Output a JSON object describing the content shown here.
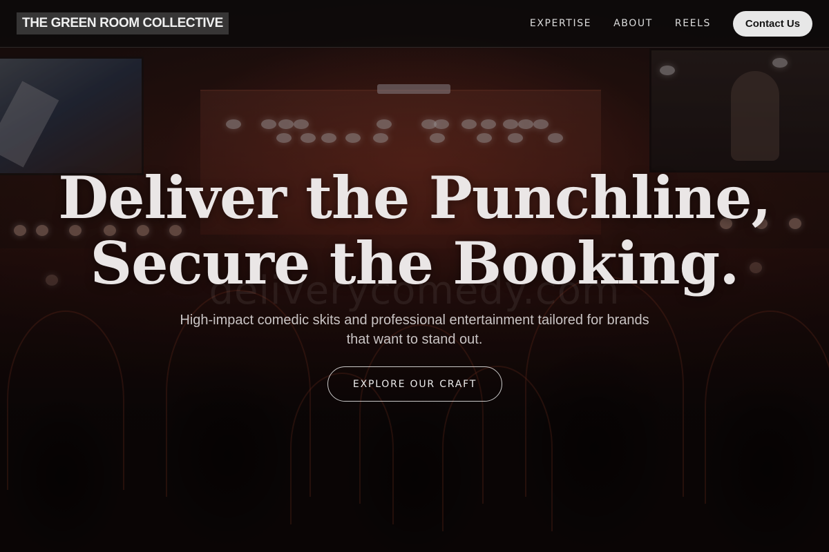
{
  "header": {
    "brand": "THE GREEN ROOM COLLECTIVE",
    "nav_links": [
      "EXPERTISE",
      "ABOUT",
      "REELS"
    ],
    "contact_label": "Contact Us"
  },
  "hero": {
    "headline_line1": "Deliver the Punchline,",
    "headline_line2": "Secure the Booking.",
    "subtitle": "High-impact comedic skits and professional entertainment tailored for brands that want to stand out.",
    "cta_label": "EXPLORE OUR CRAFT",
    "watermark": "deliverycomedy.com"
  },
  "colors": {
    "header_bg": "#0c0a0a",
    "accent_button": "#e7e7e7",
    "headline": "#eae6e6",
    "stage_glow": "#963723"
  },
  "background": {
    "description_icon": "concert-crowd-photo"
  }
}
